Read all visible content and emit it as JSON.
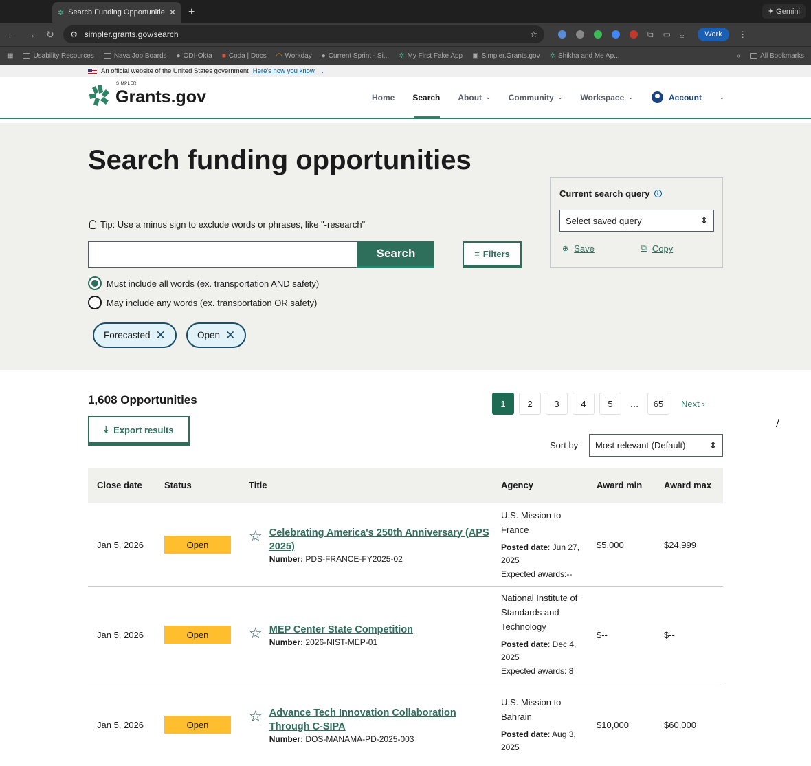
{
  "browser": {
    "tab_title": "Search Funding Opportunities",
    "new_tab": "+",
    "gemini_label": "Gemini",
    "url": "simpler.grants.gov/search",
    "profile_label": "Work",
    "bookmarks": [
      "Usability Resources",
      "Nava Job Boards",
      "ODI-Okta",
      "Coda | Docs",
      "Workday",
      "Current Sprint - Si...",
      "My First Fake App",
      "Simpler.Grants.gov",
      "Shikha and Me Ap..."
    ],
    "more_bookmarks": "»",
    "all_bookmarks": "All Bookmarks"
  },
  "gov_banner": {
    "text": "An official website of the United States government",
    "link": "Here's how you know"
  },
  "header": {
    "logo_small": "SIMPLER",
    "logo_text": "Grants.gov",
    "nav": [
      {
        "label": "Home",
        "dropdown": false
      },
      {
        "label": "Search",
        "dropdown": false,
        "active": true
      },
      {
        "label": "About",
        "dropdown": true
      },
      {
        "label": "Community",
        "dropdown": true
      },
      {
        "label": "Workspace",
        "dropdown": true
      }
    ],
    "account": "Account"
  },
  "search": {
    "title": "Search funding opportunities",
    "tip": "Tip: Use a minus sign to exclude words or phrases, like \"-research\"",
    "input_value": "",
    "button": "Search",
    "filters_button": "Filters",
    "radio_all": "Must include all words (ex. transportation AND safety)",
    "radio_any": "May include any words (ex. transportation OR safety)",
    "chips": [
      "Forecasted",
      "Open"
    ]
  },
  "query_panel": {
    "title": "Current search query",
    "select": "Select saved query",
    "save": "Save",
    "copy": "Copy"
  },
  "results": {
    "count": "1,608 Opportunities",
    "export": "Export results",
    "pages": [
      "1",
      "2",
      "3",
      "4",
      "5",
      "…",
      "65"
    ],
    "next": "Next ›",
    "sort_label": "Sort by",
    "sort_value": "Most relevant (Default)",
    "columns": [
      "Close date",
      "Status",
      "Title",
      "Agency",
      "Award min",
      "Award max"
    ],
    "rows": [
      {
        "close_date": "Jan 5, 2026",
        "status": "Open",
        "title": "Celebrating America's 250th Anniversary (APS 2025)",
        "number_label": "Number:",
        "number": "PDS-FRANCE-FY2025-02",
        "agency": "U.S. Mission to France",
        "posted_label": "Posted date",
        "posted": ": Jun 27, 2025",
        "expected": "Expected awards:--",
        "award_min": "$5,000",
        "award_max": "$24,999"
      },
      {
        "close_date": "Jan 5, 2026",
        "status": "Open",
        "title": "MEP Center State Competition",
        "number_label": "Number:",
        "number": "2026-NIST-MEP-01",
        "agency": "National Institute of Standards and Technology",
        "posted_label": "Posted date",
        "posted": ": Dec 4, 2025",
        "expected": "Expected awards: 8",
        "award_min": "$--",
        "award_max": "$--"
      },
      {
        "close_date": "Jan 5, 2026",
        "status": "Open",
        "title": "Advance Tech Innovation Collaboration Through C-SIPA",
        "number_label": "Number:",
        "number": "DOS-MANAMA-PD-2025-003",
        "agency": "U.S. Mission to Bahrain",
        "posted_label": "Posted date",
        "posted": ": Aug 3, 2025",
        "expected": "",
        "award_min": "$10,000",
        "award_max": "$60,000"
      }
    ]
  },
  "colors": {
    "primary": "#2e6f5c",
    "badge": "#ffbe2e",
    "hero_bg": "#f0f0ec",
    "chip_bg": "#e1f3f8"
  }
}
